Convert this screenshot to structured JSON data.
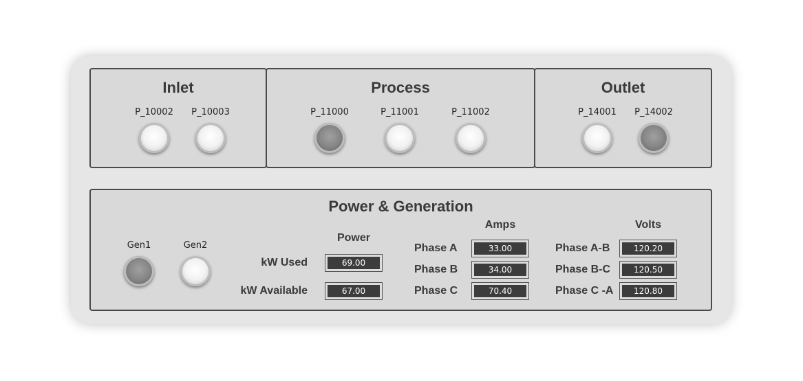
{
  "inlet": {
    "title": "Inlet",
    "pumps": [
      {
        "label": "P_10002",
        "state": "off"
      },
      {
        "label": "P_10003",
        "state": "off"
      }
    ]
  },
  "process": {
    "title": "Process",
    "pumps": [
      {
        "label": "P_11000",
        "state": "on"
      },
      {
        "label": "P_11001",
        "state": "off"
      },
      {
        "label": "P_11002",
        "state": "off"
      }
    ]
  },
  "outlet": {
    "title": "Outlet",
    "pumps": [
      {
        "label": "P_14001",
        "state": "off"
      },
      {
        "label": "P_14002",
        "state": "on"
      }
    ]
  },
  "power": {
    "title": "Power & Generation",
    "generators": [
      {
        "label": "Gen1",
        "state": "on"
      },
      {
        "label": "Gen2",
        "state": "off"
      }
    ],
    "power_header": "Power",
    "kw_used_label": "kW Used",
    "kw_used_value": "69.00",
    "kw_available_label": "kW Available",
    "kw_available_value": "67.00",
    "amps_header": "Amps",
    "amps": [
      {
        "label": "Phase A",
        "value": "33.00"
      },
      {
        "label": "Phase B",
        "value": "34.00"
      },
      {
        "label": "Phase C",
        "value": "70.40"
      }
    ],
    "volts_header": "Volts",
    "volts": [
      {
        "label": "Phase A-B",
        "value": "120.20"
      },
      {
        "label": "Phase B-C",
        "value": "120.50"
      },
      {
        "label": "Phase C -A",
        "value": "120.80"
      }
    ]
  },
  "colors": {
    "panel_bg": "#d9d9d9",
    "outer_bg": "#e6e6e6",
    "value_bg": "#3c3c3c",
    "led_on": "#808080",
    "led_off": "#f5f5f5"
  }
}
